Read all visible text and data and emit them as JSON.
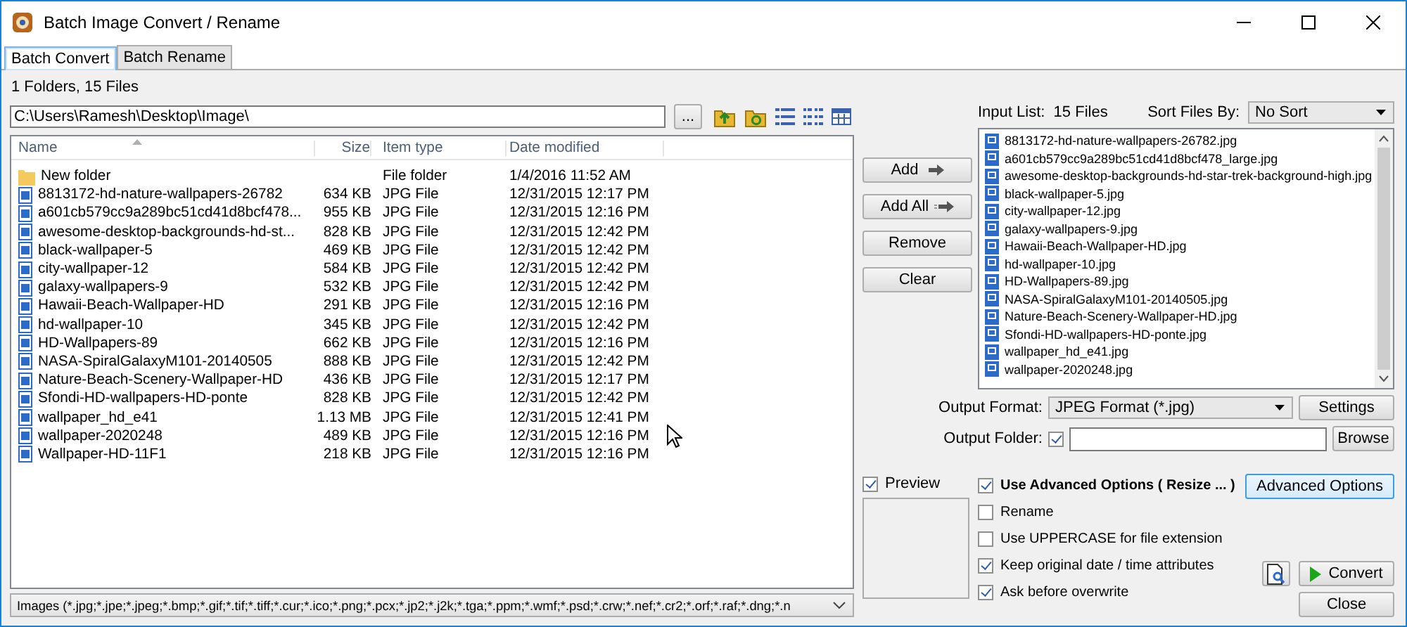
{
  "window": {
    "title": "Batch Image Convert / Rename"
  },
  "tabs": [
    {
      "label": "Batch Convert",
      "selected": true
    },
    {
      "label": "Batch Rename",
      "selected": false
    }
  ],
  "browser": {
    "summary": "1 Folders, 15 Files",
    "path": "C:\\Users\\Ramesh\\Desktop\\Image\\",
    "browse_button": "...",
    "filter": "Images (*.jpg;*.jpe;*.jpeg;*.bmp;*.gif;*.tif;*.tiff;*.cur;*.ico;*.png;*.pcx;*.jp2;*.j2k;*.tga;*.ppm;*.wmf;*.psd;*.crw;*.nef;*.cr2;*.orf;*.raf;*.dng;*.n"
  },
  "table": {
    "columns": [
      "Name",
      "Size",
      "Item type",
      "Date modified"
    ],
    "rows": [
      {
        "kind": "folder",
        "name": "New folder",
        "size": "",
        "type": "File folder",
        "date": "1/4/2016 11:52 AM"
      },
      {
        "kind": "file",
        "name": "8813172-hd-nature-wallpapers-26782",
        "size": "634 KB",
        "type": "JPG File",
        "date": "12/31/2015 12:17 PM"
      },
      {
        "kind": "file",
        "name": "a601cb579cc9a289bc51cd41d8bcf478...",
        "size": "955 KB",
        "type": "JPG File",
        "date": "12/31/2015 12:16 PM"
      },
      {
        "kind": "file",
        "name": "awesome-desktop-backgrounds-hd-st...",
        "size": "828 KB",
        "type": "JPG File",
        "date": "12/31/2015 12:42 PM"
      },
      {
        "kind": "file",
        "name": "black-wallpaper-5",
        "size": "469 KB",
        "type": "JPG File",
        "date": "12/31/2015 12:42 PM"
      },
      {
        "kind": "file",
        "name": "city-wallpaper-12",
        "size": "584 KB",
        "type": "JPG File",
        "date": "12/31/2015 12:42 PM"
      },
      {
        "kind": "file",
        "name": "galaxy-wallpapers-9",
        "size": "532 KB",
        "type": "JPG File",
        "date": "12/31/2015 12:42 PM"
      },
      {
        "kind": "file",
        "name": "Hawaii-Beach-Wallpaper-HD",
        "size": "291 KB",
        "type": "JPG File",
        "date": "12/31/2015 12:16 PM"
      },
      {
        "kind": "file",
        "name": "hd-wallpaper-10",
        "size": "345 KB",
        "type": "JPG File",
        "date": "12/31/2015 12:42 PM"
      },
      {
        "kind": "file",
        "name": "HD-Wallpapers-89",
        "size": "662 KB",
        "type": "JPG File",
        "date": "12/31/2015 12:16 PM"
      },
      {
        "kind": "file",
        "name": "NASA-SpiralGalaxyM101-20140505",
        "size": "888 KB",
        "type": "JPG File",
        "date": "12/31/2015 12:42 PM"
      },
      {
        "kind": "file",
        "name": "Nature-Beach-Scenery-Wallpaper-HD",
        "size": "436 KB",
        "type": "JPG File",
        "date": "12/31/2015 12:17 PM"
      },
      {
        "kind": "file",
        "name": "Sfondi-HD-wallpapers-HD-ponte",
        "size": "828 KB",
        "type": "JPG File",
        "date": "12/31/2015 12:42 PM"
      },
      {
        "kind": "file",
        "name": "wallpaper_hd_e41",
        "size": "1.13 MB",
        "type": "JPG File",
        "date": "12/31/2015 12:41 PM"
      },
      {
        "kind": "file",
        "name": "wallpaper-2020248",
        "size": "489 KB",
        "type": "JPG File",
        "date": "12/31/2015 12:16 PM"
      },
      {
        "kind": "file",
        "name": "Wallpaper-HD-11F1",
        "size": "218 KB",
        "type": "JPG File",
        "date": "12/31/2015 12:16 PM"
      }
    ]
  },
  "list_buttons": [
    "Add",
    "Add All",
    "Remove",
    "Clear"
  ],
  "input_list": {
    "label": "Input List:",
    "count": "15 Files",
    "sort_label": "Sort Files By:",
    "sort_value": "No Sort",
    "files": [
      "8813172-hd-nature-wallpapers-26782.jpg",
      "a601cb579cc9a289bc51cd41d8bcf478_large.jpg",
      "awesome-desktop-backgrounds-hd-star-trek-background-high.jpg",
      "black-wallpaper-5.jpg",
      "city-wallpaper-12.jpg",
      "galaxy-wallpapers-9.jpg",
      "Hawaii-Beach-Wallpaper-HD.jpg",
      "hd-wallpaper-10.jpg",
      "HD-Wallpapers-89.jpg",
      "NASA-SpiralGalaxyM101-20140505.jpg",
      "Nature-Beach-Scenery-Wallpaper-HD.jpg",
      "Sfondi-HD-wallpapers-HD-ponte.jpg",
      "wallpaper_hd_e41.jpg",
      "wallpaper-2020248.jpg"
    ]
  },
  "output": {
    "format_label": "Output Format:",
    "format_value": "JPEG Format (*.jpg)",
    "settings_button": "Settings",
    "folder_label": "Output Folder:",
    "folder_checked": true,
    "browse_button": "Browse"
  },
  "preview": {
    "label": "Preview",
    "checked": true
  },
  "options": [
    {
      "label": "Use Advanced Options ( Resize ... )",
      "checked": true,
      "bold": true
    },
    {
      "label": "Rename",
      "checked": false,
      "bold": false
    },
    {
      "label": "Use UPPERCASE for file extension",
      "checked": false,
      "bold": false
    },
    {
      "label": "Keep original date / time attributes",
      "checked": true,
      "bold": false
    },
    {
      "label": "Ask before overwrite",
      "checked": true,
      "bold": false
    }
  ],
  "advanced_button": "Advanced Options",
  "convert_button": "Convert",
  "close_button": "Close"
}
